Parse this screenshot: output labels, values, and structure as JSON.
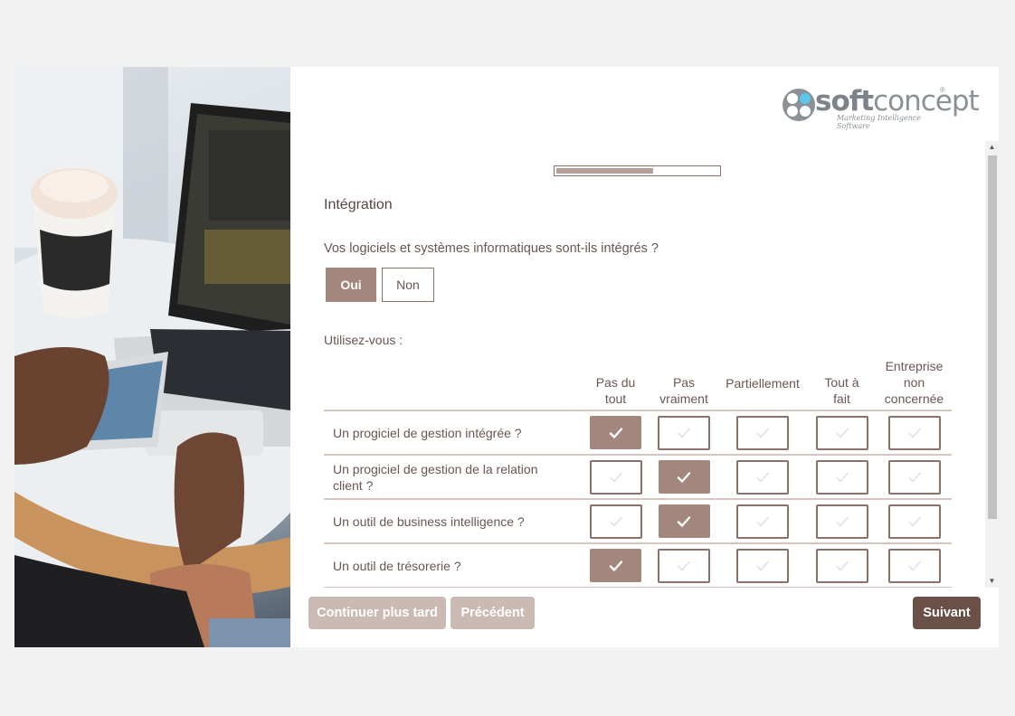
{
  "brand": {
    "name_bold": "soft",
    "name_regular": "concept",
    "registered_mark": "®",
    "tagline": "Marketing Intelligence Software",
    "logo_colors": {
      "accent_circle": "#5bc6ee",
      "grey_circles": "#8a9197"
    }
  },
  "photo": {
    "description": "laptop with coffee cup, hands typing, smartphone"
  },
  "progress": {
    "percent": 60,
    "fill_color": "#b4a09a",
    "border_color": "#8b716a"
  },
  "survey": {
    "section_title": "Intégration",
    "question_integrated": {
      "text": "Vos logiciels et systèmes informatiques sont-ils intégrés ?",
      "options": [
        "Oui",
        "Non"
      ],
      "selected": "Oui"
    },
    "matrix": {
      "prompt": "Utilisez-vous :",
      "columns": [
        "Pas du tout",
        "Pas vraiment",
        "Partiellement",
        "Tout à fait",
        "Entreprise non concernée"
      ],
      "column_lines": [
        [
          "Pas du",
          "tout"
        ],
        [
          "Pas",
          "vraiment"
        ],
        [
          "Partiellement"
        ],
        [
          "Tout à",
          "fait"
        ],
        [
          "Entreprise",
          "non",
          "concernée"
        ]
      ],
      "rows": [
        {
          "label": "Un progiciel de gestion intégrée ?",
          "selected_index": 0
        },
        {
          "label": "Un progiciel de gestion de la relation client ?",
          "selected_index": 1
        },
        {
          "label": "Un outil de business intelligence ?",
          "selected_index": 1
        },
        {
          "label": "Un outil de trésorerie ?",
          "selected_index": 0
        }
      ]
    }
  },
  "buttons": {
    "continue_later": "Continuer plus tard",
    "previous": "Précédent",
    "next": "Suivant"
  },
  "scrollbar": {
    "up_arrow": "▲",
    "down_arrow": "▼"
  },
  "colors": {
    "primary": "#a3877c",
    "primary_dark": "#6b5048",
    "disabled": "#cbb9b3",
    "text": "#6b5651",
    "divider": "#d7c6bf"
  }
}
